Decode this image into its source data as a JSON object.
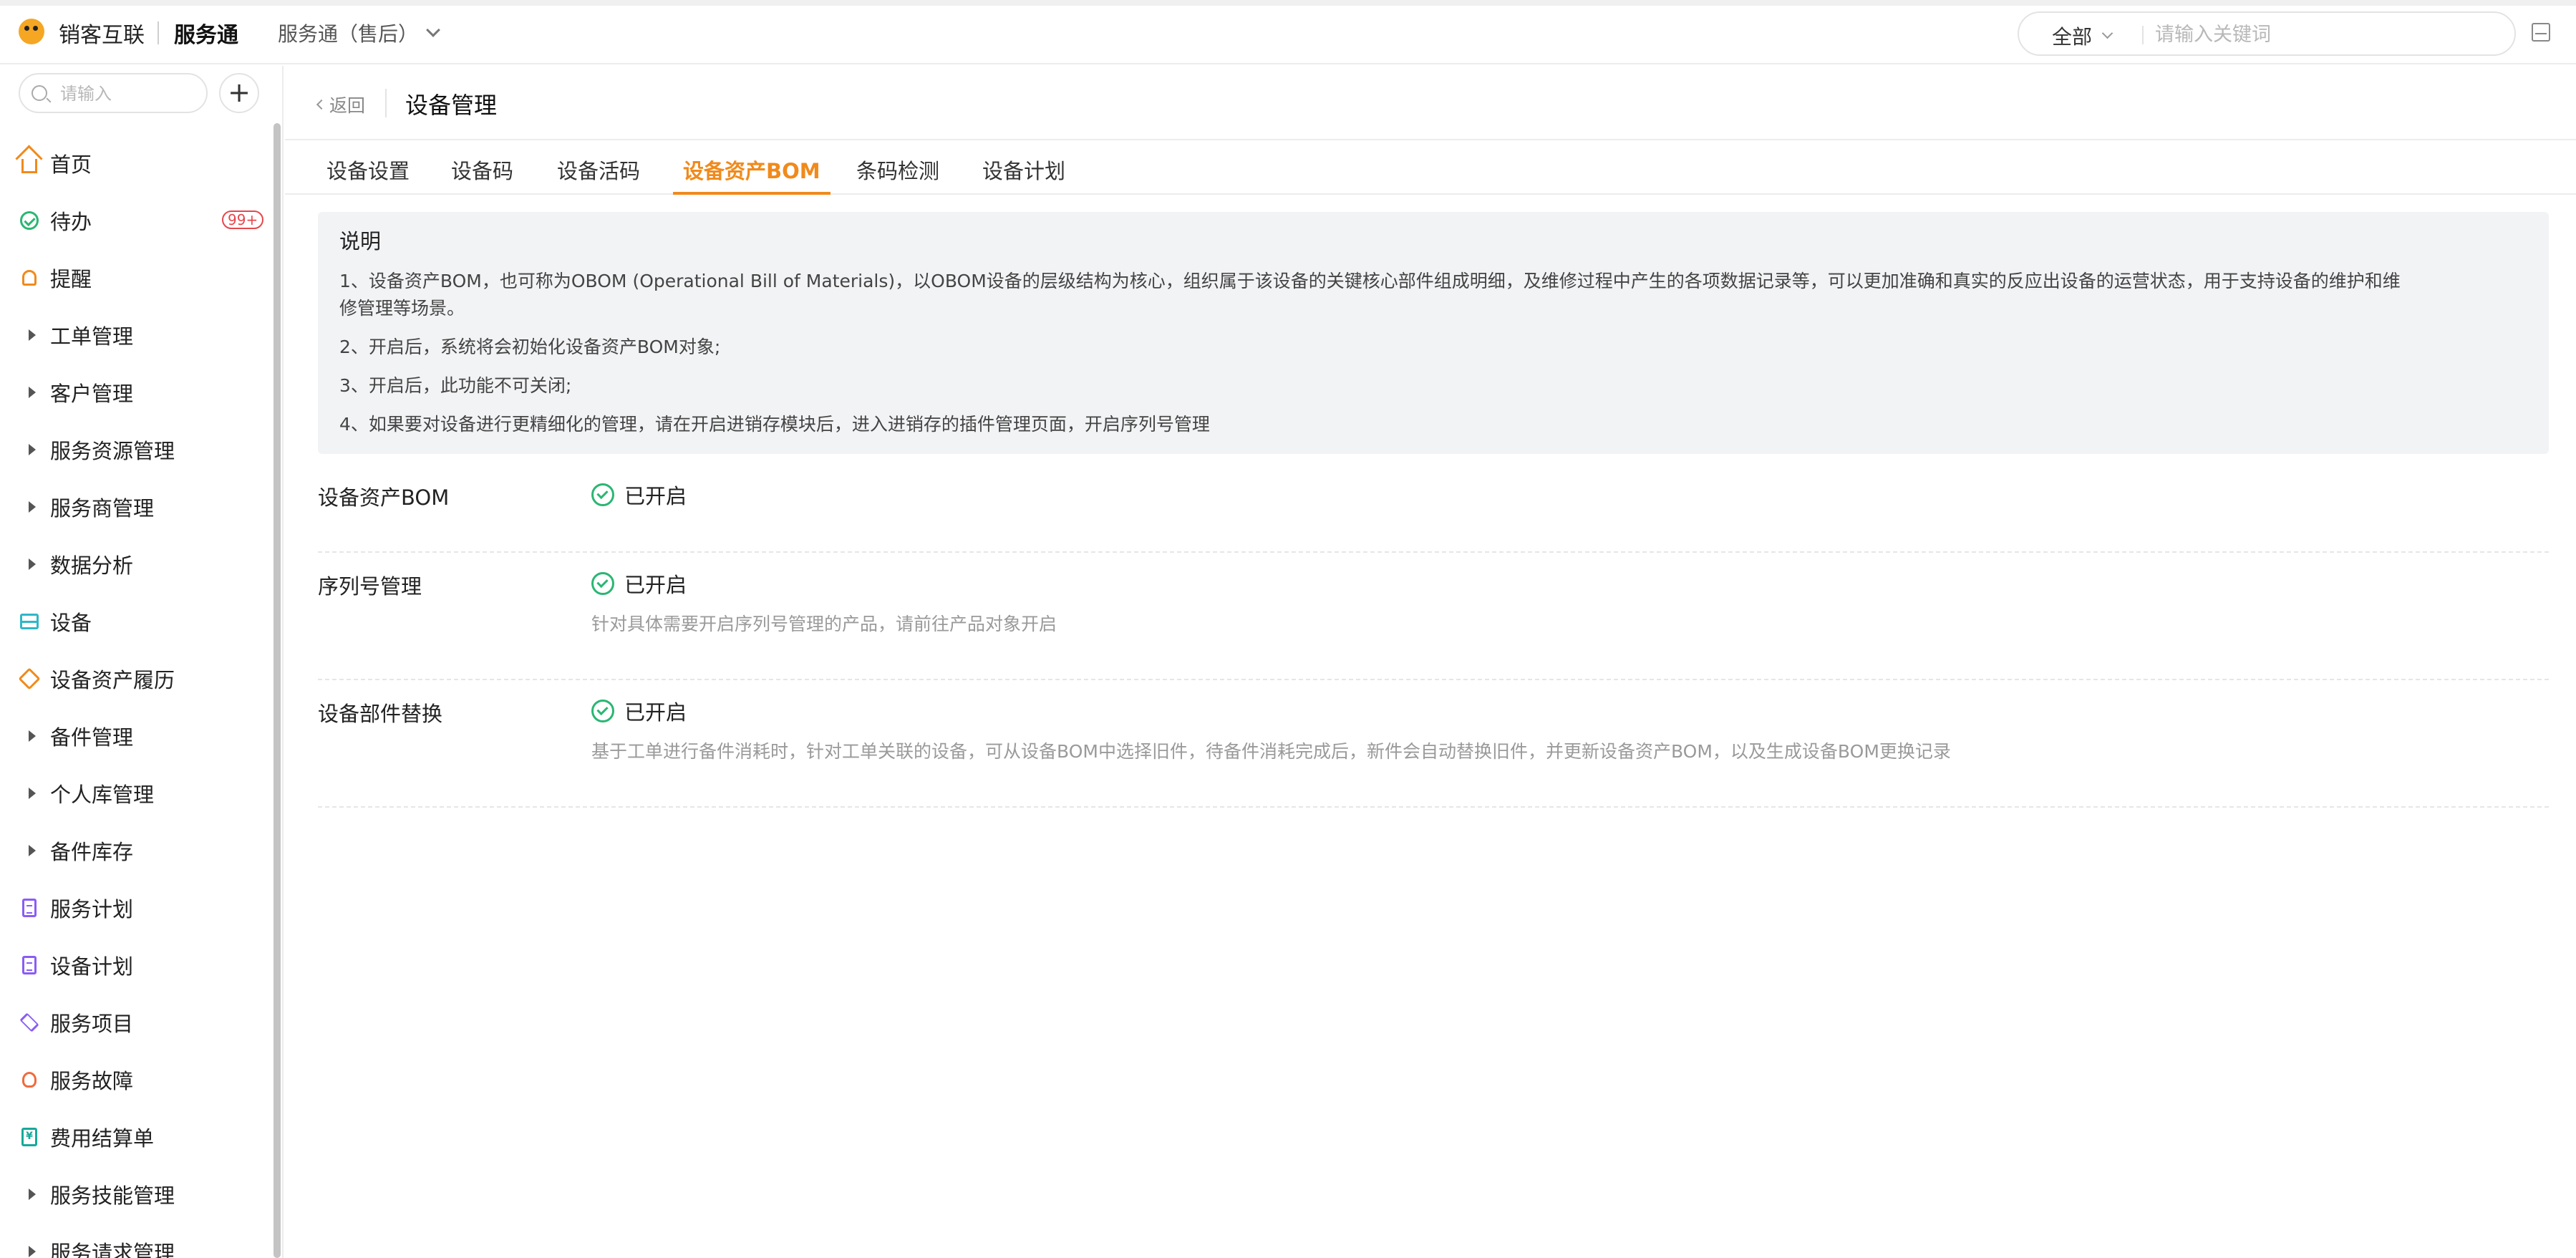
{
  "topbar": {
    "brand": "销客互联",
    "product": "服务通",
    "switcher": "服务通（售后）",
    "search_scope": "全部",
    "search_placeholder": "请输入关键词"
  },
  "sidebar": {
    "search_placeholder": "请输入",
    "add_label": "+",
    "items": [
      {
        "label": "首页",
        "icon": "home-icon"
      },
      {
        "label": "待办",
        "icon": "check-circle-icon",
        "badge": "99+"
      },
      {
        "label": "提醒",
        "icon": "bell-icon"
      },
      {
        "label": "工单管理",
        "icon": "caret-right-icon"
      },
      {
        "label": "客户管理",
        "icon": "caret-right-icon"
      },
      {
        "label": "服务资源管理",
        "icon": "caret-right-icon"
      },
      {
        "label": "服务商管理",
        "icon": "caret-right-icon"
      },
      {
        "label": "数据分析",
        "icon": "caret-right-icon"
      },
      {
        "label": "设备",
        "icon": "server-icon"
      },
      {
        "label": "设备资产履历",
        "icon": "gem-icon"
      },
      {
        "label": "备件管理",
        "icon": "caret-right-icon"
      },
      {
        "label": "个人库管理",
        "icon": "caret-right-icon"
      },
      {
        "label": "备件库存",
        "icon": "caret-right-icon"
      },
      {
        "label": "服务计划",
        "icon": "document-icon"
      },
      {
        "label": "设备计划",
        "icon": "document-icon"
      },
      {
        "label": "服务项目",
        "icon": "layers-icon"
      },
      {
        "label": "服务故障",
        "icon": "bulb-icon"
      },
      {
        "label": "费用结算单",
        "icon": "bill-icon"
      },
      {
        "label": "服务技能管理",
        "icon": "caret-right-icon"
      },
      {
        "label": "服务请求管理",
        "icon": "caret-right-icon"
      }
    ]
  },
  "page": {
    "back_label": "返回",
    "title": "设备管理",
    "tabs": [
      "设备设置",
      "设备码",
      "设备活码",
      "设备资产BOM",
      "条码检测",
      "设备计划"
    ],
    "active_tab": "设备资产BOM"
  },
  "note": {
    "title": "说明",
    "lines": [
      "1、设备资产BOM，也可称为OBOM (Operational Bill of Materials)，以OBOM设备的层级结构为核心，组织属于该设备的关键核心部件组成明细，及维修过程中产生的各项数据记录等，可以更加准确和真实的反应出设备的运营状态，用于支持设备的维护和维修管理等场景。",
      "2、开启后，系统将会初始化设备资产BOM对象;",
      "3、开启后，此功能不可关闭;",
      "4、如果要对设备进行更精细化的管理，请在开启进销存模块后，进入进销存的插件管理页面，开启序列号管理"
    ]
  },
  "settings": [
    {
      "label": "设备资产BOM",
      "status": "已开启",
      "desc": ""
    },
    {
      "label": "序列号管理",
      "status": "已开启",
      "desc": "针对具体需要开启序列号管理的产品，请前往产品对象开启"
    },
    {
      "label": "设备部件替换",
      "status": "已开启",
      "desc": "基于工单进行备件消耗时，针对工单关联的设备，可从设备BOM中选择旧件，待备件消耗完成后，新件会自动替换旧件，并更新设备资产BOM，以及生成设备BOM更换记录"
    }
  ],
  "colors": {
    "accent": "#f08a1c",
    "success": "#2bb673",
    "badge": "#e5484d"
  }
}
